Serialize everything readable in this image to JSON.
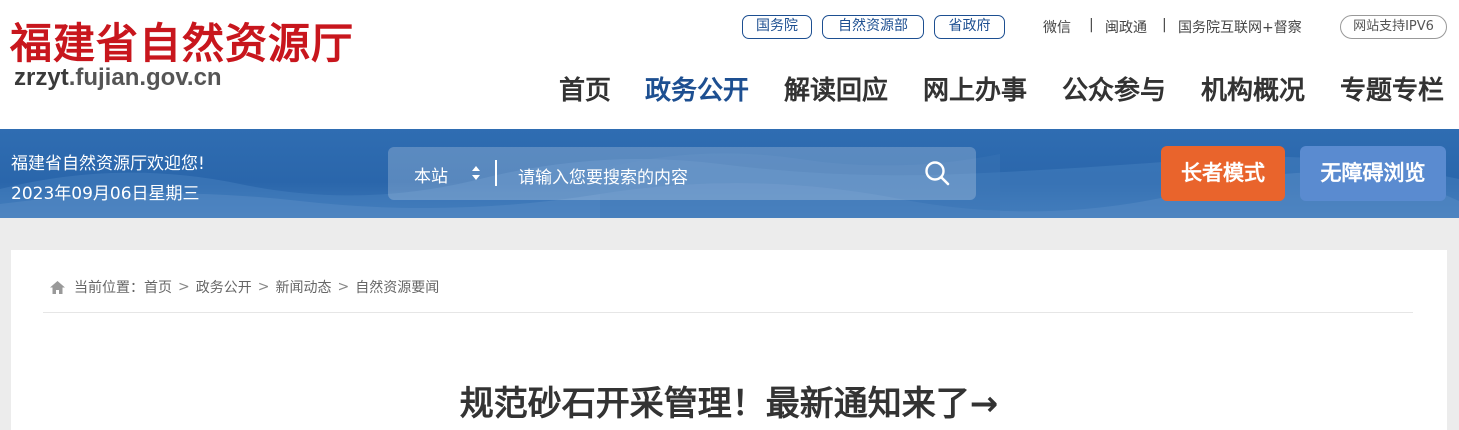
{
  "logo": {
    "title_cn": "福建省自然资源厅",
    "domain_a": "zrzyt",
    "domain_b": ".fujian.gov.cn"
  },
  "top_pills": [
    "国务院",
    "自然资源部",
    "省政府"
  ],
  "top_links": {
    "wechat": "微信",
    "minzhengtong": "闽政通",
    "gwy_app": "国务院互联网+督察",
    "sep": "|"
  },
  "ipv6": "网站支持IPV6",
  "nav": [
    "首页",
    "政务公开",
    "解读回应",
    "网上办事",
    "公众参与",
    "机构概况",
    "专题专栏"
  ],
  "nav_active": "政务公开",
  "banner": {
    "welcome": "福建省自然资源厅欢迎您!",
    "date": "2023年09月06日星期三",
    "search_scope": "本站",
    "search_placeholder": "请输入您要搜索的内容",
    "elder_mode": "长者模式",
    "accessibility": "无障碍浏览"
  },
  "breadcrumb": {
    "prefix": "当前位置：",
    "items": [
      "首页",
      "政务公开",
      "新闻动态",
      "自然资源要闻"
    ],
    "sep": ">"
  },
  "article": {
    "title": "规范砂石开采管理！最新通知来了→"
  },
  "colors": {
    "brand_red": "#c8161d",
    "brand_blue": "#1d4f91",
    "banner_blue": "#2f6db2",
    "elder_orange": "#e9642c",
    "access_blue": "#5a8bd0"
  },
  "icons": [
    "search-icon",
    "home-icon",
    "updown-arrows-icon"
  ]
}
